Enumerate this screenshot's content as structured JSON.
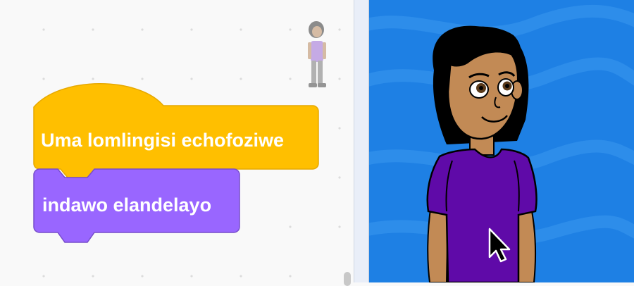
{
  "blocks": {
    "hat": {
      "label": "Uma lomlingisi echofoziwe",
      "color": "#ffbf00",
      "border": "#e6a800"
    },
    "command": {
      "label": "indawo elandelayo",
      "color": "#9966ff",
      "border": "#774dcb"
    }
  },
  "colors": {
    "stage_background": "#1e80e4",
    "workspace_background": "#f9f9f9"
  },
  "icons": {
    "sprite_thumbnail": "sprite-thumbnail-icon",
    "cursor": "mouse-cursor-icon"
  }
}
